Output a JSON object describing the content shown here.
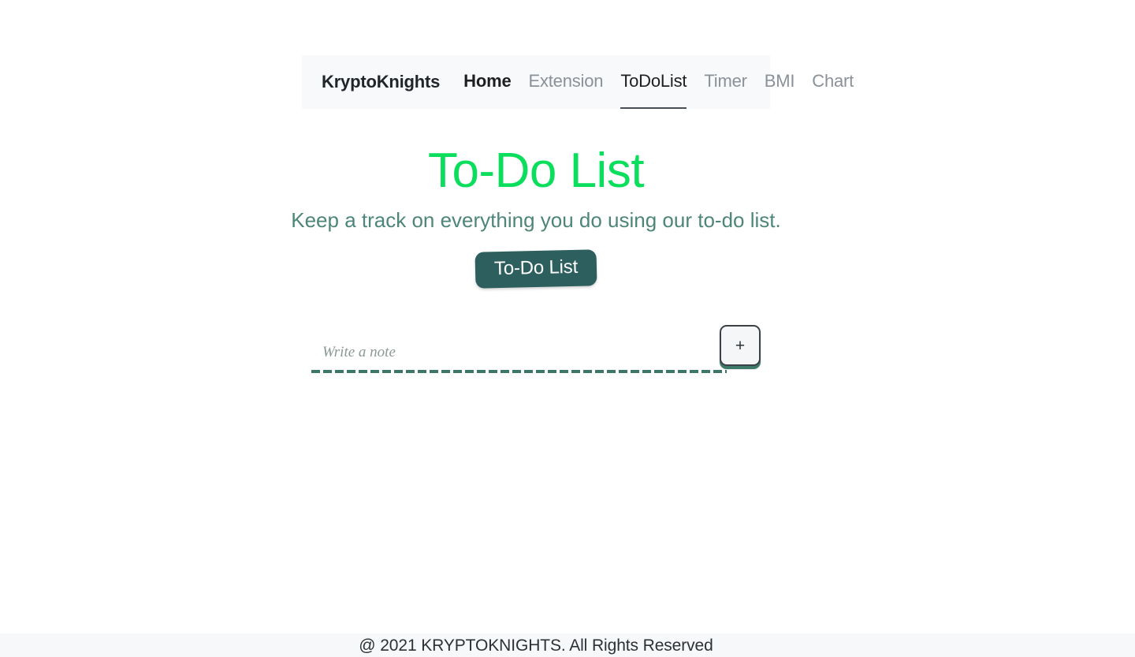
{
  "navbar": {
    "brand": "KryptoKnights",
    "links": [
      {
        "label": "Home",
        "state": "visited"
      },
      {
        "label": "Extension",
        "state": "normal"
      },
      {
        "label": "ToDoList",
        "state": "current"
      },
      {
        "label": "Timer",
        "state": "normal"
      },
      {
        "label": "BMI",
        "state": "normal"
      },
      {
        "label": "Chart",
        "state": "normal"
      }
    ]
  },
  "hero": {
    "title": "To-Do List",
    "subtitle": "Keep a track on everything you do using our to-do list.",
    "title_color": "#0ade5c",
    "subtitle_color": "#4d8679"
  },
  "actions": {
    "todo_button_label": "To-Do List",
    "todo_button_color": "#2e5f5f"
  },
  "note_form": {
    "placeholder": "Write a note",
    "value": "",
    "add_button_label": "+",
    "underline_color": "#3d7566",
    "add_button_accent": "#3e7a69"
  },
  "footer": {
    "text": "@ 2021 KRYPTOKNIGHTS. All Rights Reserved",
    "background": "#f6f8fa"
  }
}
